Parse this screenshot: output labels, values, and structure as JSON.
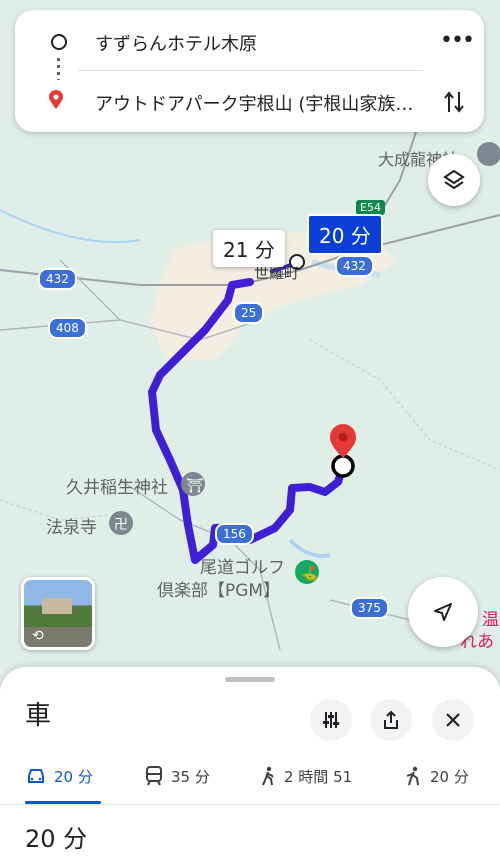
{
  "route": {
    "origin": "すずらんホテル木原",
    "destination": "アウトドアパーク宇根山 (宇根山家族…"
  },
  "map": {
    "bubble_alt": "21 分",
    "bubble_selected": "20 分",
    "places": {
      "town": "世羅町",
      "taisei": "大成龍神社",
      "kui": "久井稲生神社",
      "hosen": "法泉寺",
      "golf_line1": "尾道ゴルフ",
      "golf_line2": "倶楽部【PGM】",
      "onsen_line1": "温",
      "onsen_line2": "れあ"
    },
    "road_shields": {
      "r432a": "432",
      "r432b": "432",
      "r408": "408",
      "r25": "25",
      "r156": "156",
      "r375": "375",
      "e54": "E54"
    }
  },
  "sheet": {
    "title": "車",
    "tabs": [
      {
        "icon": "car-icon",
        "label": "20 分"
      },
      {
        "icon": "train-icon",
        "label": "35 分"
      },
      {
        "icon": "walk-icon",
        "label": "2 時間 51"
      },
      {
        "icon": "ride-icon",
        "label": "20 分"
      }
    ],
    "summary": "20 分"
  },
  "colors": {
    "route": "#3f1fd6",
    "accent": "#0b57d0",
    "map_bg": "#dfeee6"
  }
}
